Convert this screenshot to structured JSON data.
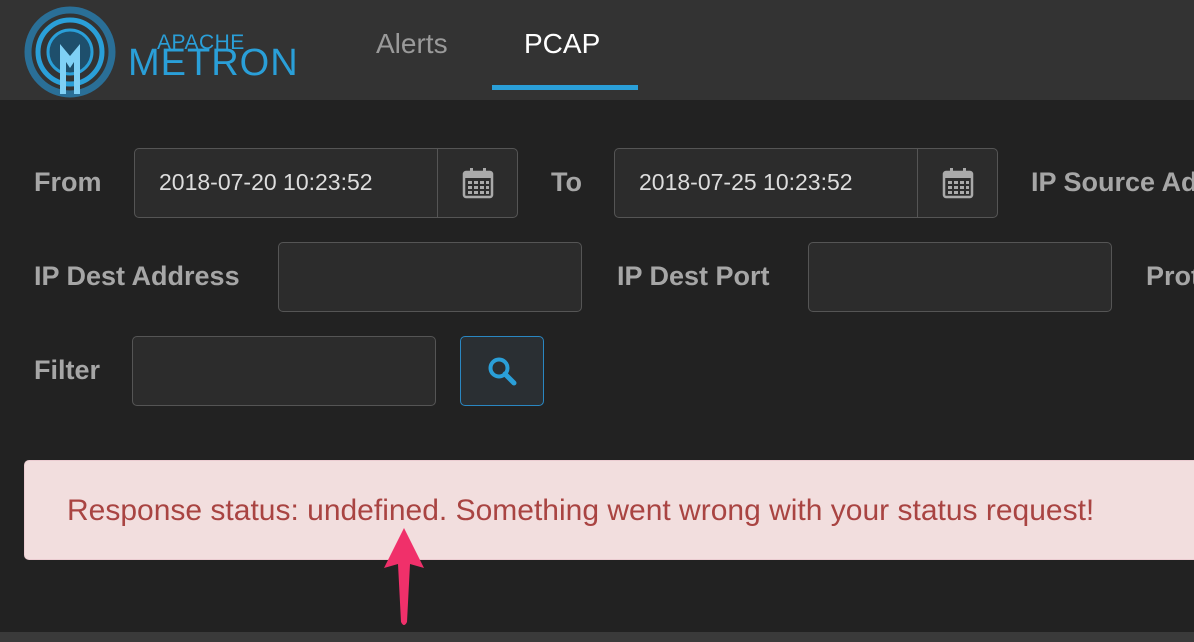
{
  "brand": {
    "top_word": "APACHE",
    "main_word": "METRON"
  },
  "nav": {
    "tabs": [
      {
        "label": "Alerts",
        "active": false
      },
      {
        "label": "PCAP",
        "active": true
      }
    ]
  },
  "form": {
    "from_label": "From",
    "from_value": "2018-07-20 10:23:52",
    "to_label": "To",
    "to_value": "2018-07-25 10:23:52",
    "ip_source_label": "IP Source Ad",
    "ip_dest_address_label": "IP Dest Address",
    "ip_dest_address_value": "",
    "ip_dest_port_label": "IP Dest Port",
    "ip_dest_port_value": "",
    "protocol_label": "Prot",
    "filter_label": "Filter",
    "filter_value": ""
  },
  "alert": {
    "message": "Response status: undefined. Something went wrong with your status request!"
  },
  "icons": {
    "calendar": "calendar-icon",
    "search": "search-icon",
    "annotation_arrow": "arrow-up-icon"
  },
  "colors": {
    "accent": "#2a9fd8",
    "alert_bg": "#f2dede",
    "alert_text": "#a94442",
    "arrow": "#f0306a"
  }
}
